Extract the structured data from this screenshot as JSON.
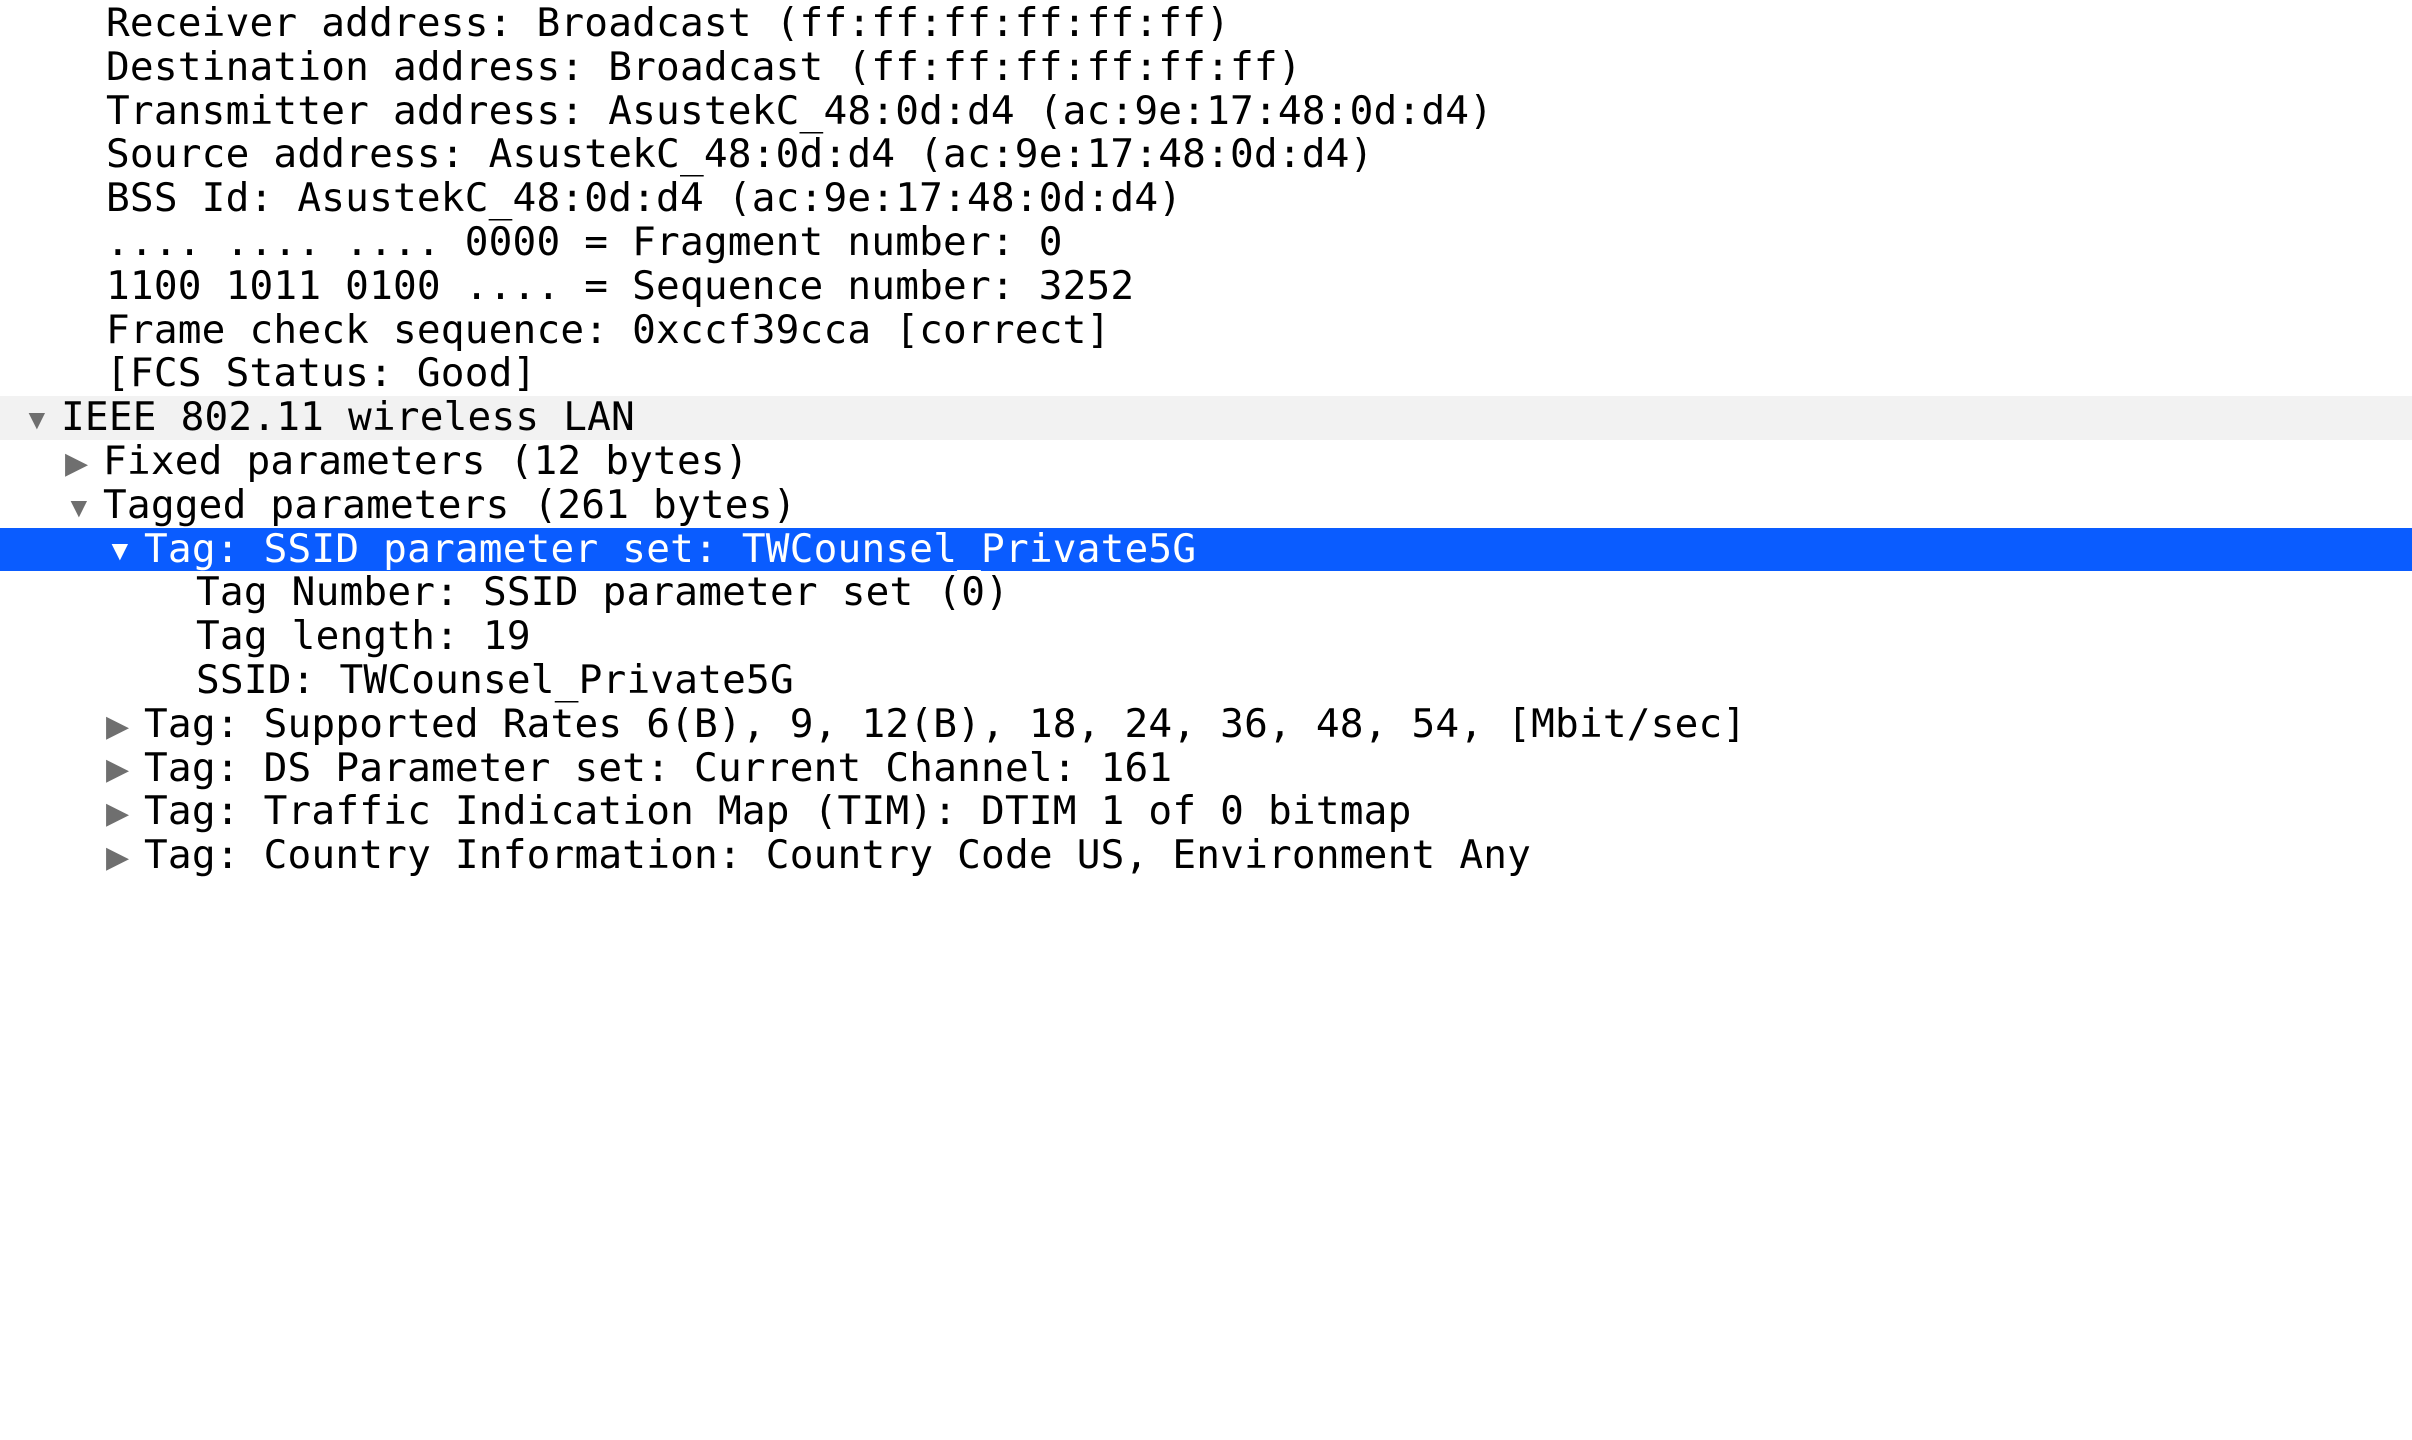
{
  "lines": {
    "receiver": "Receiver address: Broadcast (ff:ff:ff:ff:ff:ff)",
    "destination": "Destination address: Broadcast (ff:ff:ff:ff:ff:ff)",
    "transmitter": "Transmitter address: AsustekC_48:0d:d4 (ac:9e:17:48:0d:d4)",
    "source": "Source address: AsustekC_48:0d:d4 (ac:9e:17:48:0d:d4)",
    "bssid": "BSS Id: AsustekC_48:0d:d4 (ac:9e:17:48:0d:d4)",
    "fragment": ".... .... .... 0000 = Fragment number: 0",
    "sequence": "1100 1011 0100 .... = Sequence number: 3252",
    "fcs": "Frame check sequence: 0xccf39cca [correct]",
    "fcs_status": "[FCS Status: Good]",
    "ieee": "IEEE 802.11 wireless LAN",
    "fixed": "Fixed parameters (12 bytes)",
    "tagged": "Tagged parameters (261 bytes)",
    "ssid_tag": "Tag: SSID parameter set: TWCounsel_Private5G",
    "tag_number": "Tag Number: SSID parameter set (0)",
    "tag_length": "Tag length: 19",
    "ssid": "SSID: TWCounsel_Private5G",
    "rates": "Tag: Supported Rates 6(B), 9, 12(B), 18, 24, 36, 48, 54, [Mbit/sec]",
    "ds": "Tag: DS Parameter set: Current Channel: 161",
    "tim": "Tag: Traffic Indication Map (TIM): DTIM 1 of 0 bitmap",
    "country": "Tag: Country Information: Country Code US, Environment Any"
  }
}
